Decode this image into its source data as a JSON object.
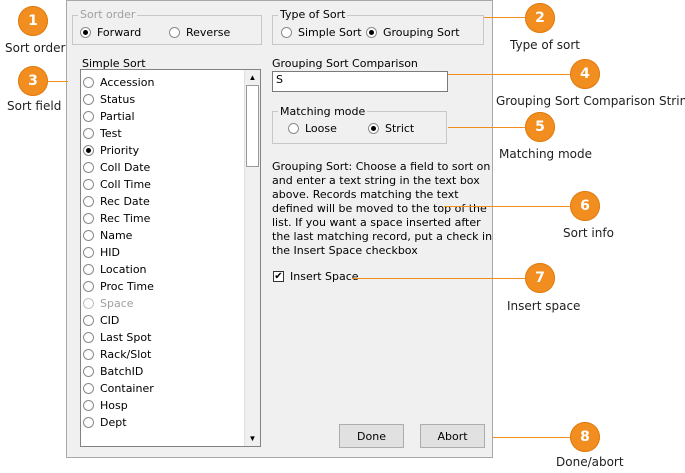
{
  "sort_order": {
    "title": "Sort order",
    "options": [
      {
        "label": "Forward",
        "checked": true
      },
      {
        "label": "Reverse",
        "checked": false
      }
    ]
  },
  "type_of_sort": {
    "title": "Type of Sort",
    "options": [
      {
        "label": "Simple Sort",
        "checked": false
      },
      {
        "label": "Grouping Sort",
        "checked": true
      }
    ]
  },
  "simple_sort": {
    "title": "Simple Sort",
    "items": [
      {
        "label": "Accession",
        "checked": false,
        "enabled": true
      },
      {
        "label": "Status",
        "checked": false,
        "enabled": true
      },
      {
        "label": "Partial",
        "checked": false,
        "enabled": true
      },
      {
        "label": "Test",
        "checked": false,
        "enabled": true
      },
      {
        "label": "Priority",
        "checked": true,
        "enabled": true
      },
      {
        "label": "Coll Date",
        "checked": false,
        "enabled": true
      },
      {
        "label": "Coll Time",
        "checked": false,
        "enabled": true
      },
      {
        "label": "Rec Date",
        "checked": false,
        "enabled": true
      },
      {
        "label": "Rec Time",
        "checked": false,
        "enabled": true
      },
      {
        "label": "Name",
        "checked": false,
        "enabled": true
      },
      {
        "label": "HID",
        "checked": false,
        "enabled": true
      },
      {
        "label": "Location",
        "checked": false,
        "enabled": true
      },
      {
        "label": "Proc Time",
        "checked": false,
        "enabled": true
      },
      {
        "label": "Space",
        "checked": false,
        "enabled": false
      },
      {
        "label": "CID",
        "checked": false,
        "enabled": true
      },
      {
        "label": "Last Spot",
        "checked": false,
        "enabled": true
      },
      {
        "label": "Rack/Slot",
        "checked": false,
        "enabled": true
      },
      {
        "label": "BatchID",
        "checked": false,
        "enabled": true
      },
      {
        "label": "Container",
        "checked": false,
        "enabled": true
      },
      {
        "label": "Hosp",
        "checked": false,
        "enabled": true
      },
      {
        "label": "Dept",
        "checked": false,
        "enabled": true
      }
    ]
  },
  "grouping_comparison": {
    "label": "Grouping Sort Comparison",
    "value": "S"
  },
  "matching_mode": {
    "title": "Matching mode",
    "options": [
      {
        "label": "Loose",
        "checked": false
      },
      {
        "label": "Strict",
        "checked": true
      }
    ]
  },
  "sort_info": {
    "lines": [
      "Grouping Sort: Choose a field to sort on",
      "and enter a text string in the text box",
      "above.  Records matching the text",
      "defined will be moved to the top of the",
      "list.  If you want a space inserted after",
      "the last matching record, put a check in",
      "the Insert Space checkbox"
    ]
  },
  "insert_space": {
    "label": "Insert Space",
    "checked": true,
    "mark": "✔"
  },
  "buttons": {
    "done": "Done",
    "abort": "Abort"
  },
  "scrollbar": {
    "up": "▲",
    "down": "▼"
  },
  "callouts": [
    {
      "number": "1",
      "label": "Sort order"
    },
    {
      "number": "2",
      "label": "Type of sort"
    },
    {
      "number": "3",
      "label": "Sort field"
    },
    {
      "number": "4",
      "label": "Grouping Sort Comparison String"
    },
    {
      "number": "5",
      "label": "Matching mode"
    },
    {
      "number": "6",
      "label": "Sort info"
    },
    {
      "number": "7",
      "label": "Insert space"
    },
    {
      "number": "8",
      "label": "Done/abort"
    }
  ],
  "colors": {
    "callout_badge": "#f28d1f",
    "dialog_bg": "#f0f0f0"
  }
}
